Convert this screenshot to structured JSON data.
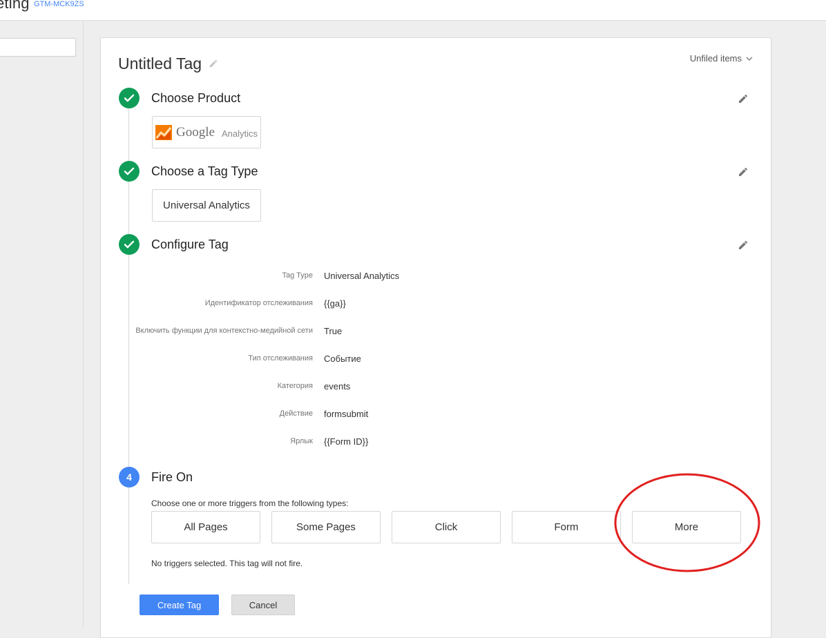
{
  "header": {
    "app_title": "eting",
    "container_id": "GTM-MCK9ZS"
  },
  "tag": {
    "title": "Untitled Tag",
    "folder": "Unfiled items"
  },
  "steps": {
    "product": {
      "title": "Choose Product",
      "product_brand": "Google",
      "product_name": "Analytics"
    },
    "tag_type": {
      "title": "Choose a Tag Type",
      "value": "Universal Analytics"
    },
    "configure": {
      "title": "Configure Tag",
      "rows": [
        {
          "label": "Tag Type",
          "value": "Universal Analytics"
        },
        {
          "label": "Идентификатор отслеживания",
          "value": "{{ga}}"
        },
        {
          "label": "Включить функции для контекстно-медийной сети",
          "value": "True"
        },
        {
          "label": "Тип отслеживания",
          "value": "Событие"
        },
        {
          "label": "Категория",
          "value": "events"
        },
        {
          "label": "Действие",
          "value": "formsubmit"
        },
        {
          "label": "Ярлык",
          "value": "{{Form ID}}"
        }
      ]
    },
    "fire_on": {
      "number": "4",
      "title": "Fire On",
      "hint": "Choose one or more triggers from the following types:",
      "triggers": [
        "All Pages",
        "Some Pages",
        "Click",
        "Form",
        "More"
      ],
      "status": "No triggers selected. This tag will not fire."
    }
  },
  "actions": {
    "create_label": "Create Tag",
    "cancel_label": "Cancel"
  },
  "icons": {
    "check": "check-icon",
    "pencil": "pencil-icon",
    "chevron": "chevron-down-icon",
    "ga_logo": "google-analytics-logo"
  },
  "colors": {
    "done": "#0f9d58",
    "active": "#4285f4",
    "primary_button": "#4285f4",
    "annotation": "#e0201f"
  }
}
